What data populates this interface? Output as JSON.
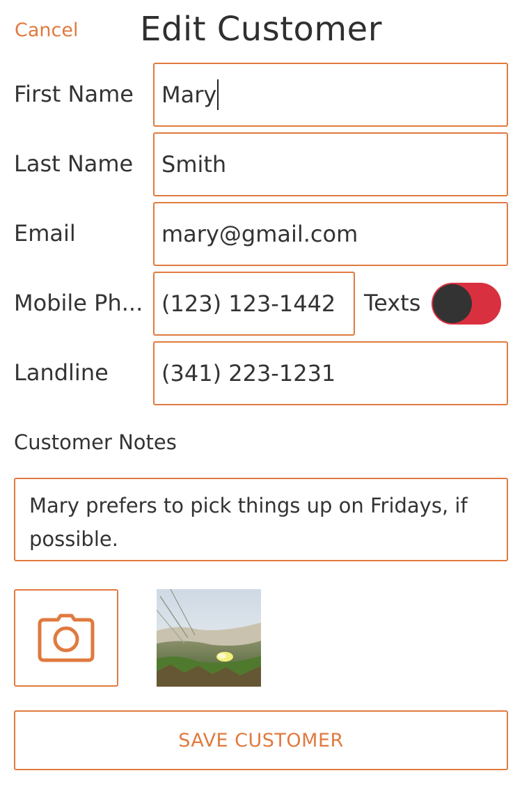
{
  "header": {
    "cancel_label": "Cancel",
    "title": "Edit Customer"
  },
  "form": {
    "first_name": {
      "label": "First Name",
      "value": "Mary"
    },
    "last_name": {
      "label": "Last Name",
      "value": "Smith"
    },
    "email": {
      "label": "Email",
      "value": "mary@gmail.com"
    },
    "mobile_phone": {
      "label": "Mobile Ph...",
      "value": "(123) 123-1442"
    },
    "texts": {
      "label": "Texts",
      "enabled": true
    },
    "landline": {
      "label": "Landline",
      "value": "(341) 223-1231"
    },
    "notes": {
      "label": "Customer Notes",
      "value": "Mary prefers to pick things up on Fridays, if possible."
    }
  },
  "attachments": {
    "camera_icon": "camera-icon",
    "photo": "beach-dune-flower-photo"
  },
  "actions": {
    "save_label": "SAVE CUSTOMER"
  },
  "colors": {
    "accent": "#e07a3f",
    "toggle_on": "#d9303f",
    "text": "#333333"
  }
}
